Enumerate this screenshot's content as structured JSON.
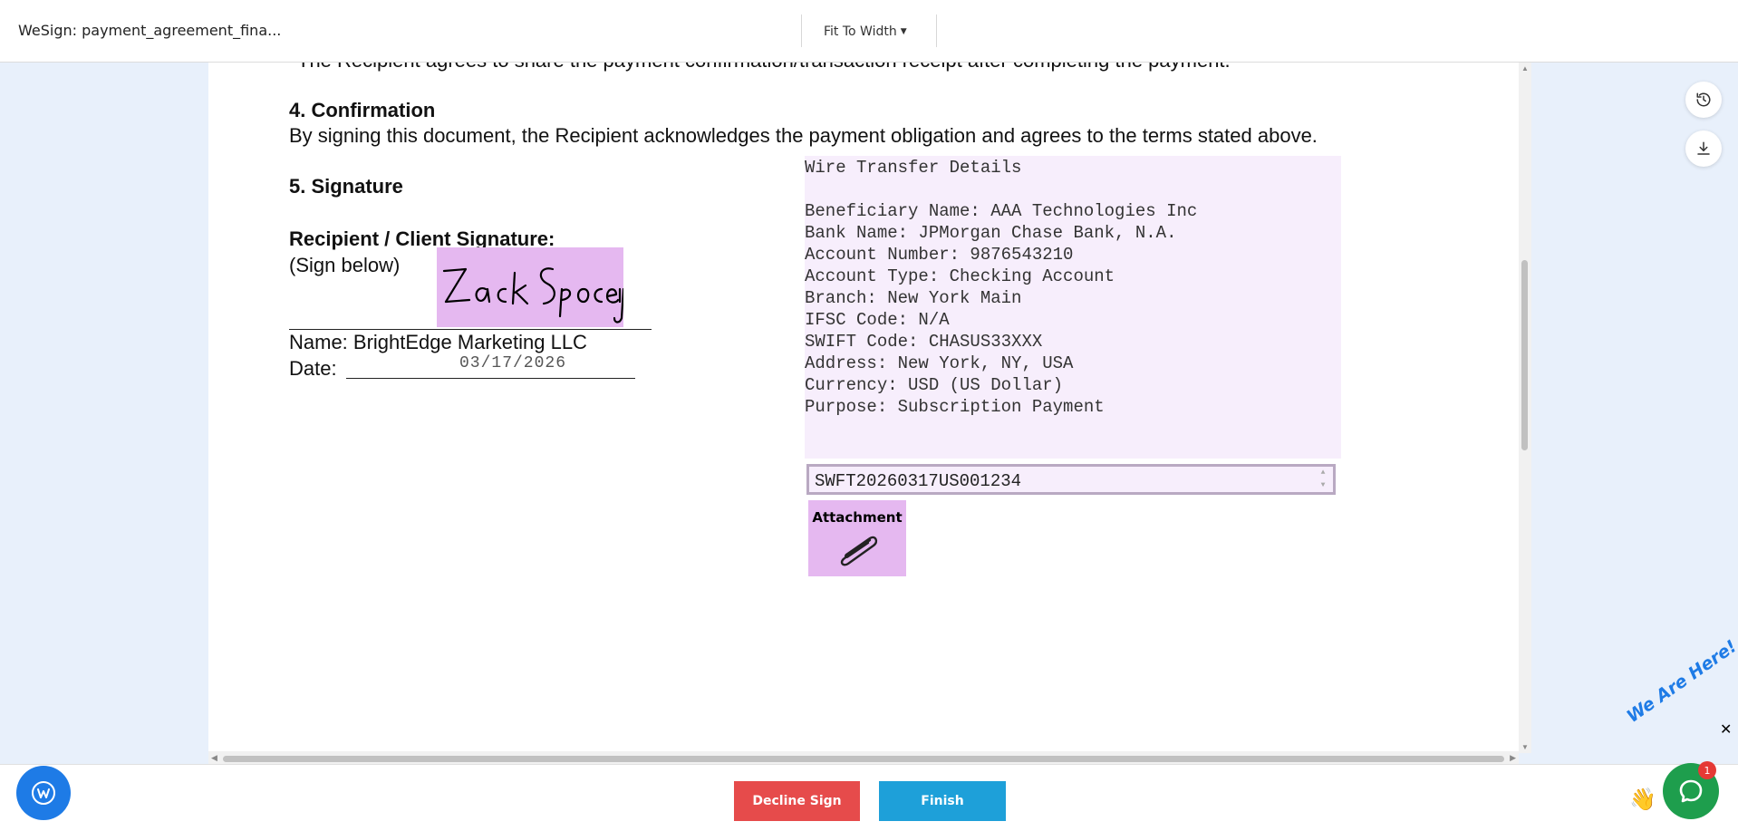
{
  "header": {
    "title": "WeSign: payment_agreement_fina...",
    "zoom_label": "Fit To Width"
  },
  "document": {
    "partial_line": "The Recipient agrees to share the payment confirmation/transaction receipt after completing the payment.",
    "section4_heading": "4. Confirmation",
    "section4_body": "By signing this document, the Recipient acknowledges the payment obligation and agrees to the terms stated above.",
    "section5_heading": "5. Signature",
    "recipient_label": "Recipient / Client Signature:",
    "sign_below": "(Sign below)",
    "signature_text": "Zack Spacey",
    "name_line": "Name: BrightEdge Marketing LLC",
    "date_label": "Date:",
    "date_value": "03/17/2026",
    "wire_transfer": {
      "title": "Wire Transfer Details",
      "beneficiary": "Beneficiary Name: AAA Technologies Inc",
      "bank": "Bank Name: JPMorgan Chase Bank, N.A.",
      "account_number": "Account Number: 9876543210",
      "account_type": "Account Type: Checking Account",
      "branch": "Branch: New York Main",
      "ifsc": "IFSC Code: N/A",
      "swift": "SWIFT Code: CHASUS33XXX",
      "address": "Address: New York, NY, USA",
      "currency": "Currency: USD (US Dollar)",
      "purpose": "Purpose: Subscription Payment"
    },
    "reference_value": "SWFT20260317US001234",
    "attachment_label": "Attachment"
  },
  "footer": {
    "decline_label": "Decline Sign",
    "finish_label": "Finish"
  },
  "chat": {
    "tagline": "We Are Here!",
    "badge_count": "1",
    "close_symbol": "✕"
  },
  "icons": {
    "history": "history-icon",
    "download": "download-icon",
    "paperclip": "paperclip-icon",
    "chat": "chat-icon"
  },
  "colors": {
    "field_highlight": "#e5b8f0",
    "decline": "#e64b4b",
    "finish": "#1ea0d9",
    "chat": "#1e9e4d"
  }
}
